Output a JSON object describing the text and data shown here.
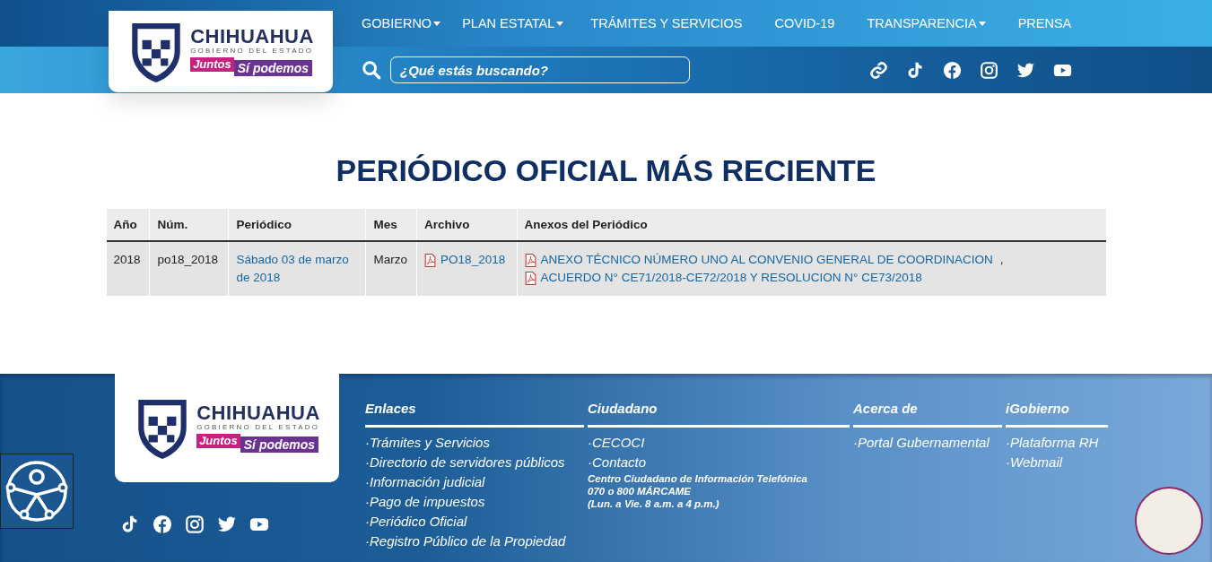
{
  "header": {
    "logo": {
      "name": "CHIHUAHUA",
      "subtitle": "GOBIERNO DEL ESTADO",
      "slogan_1": "Juntos",
      "slogan_2": "Sí podemos"
    },
    "nav": [
      {
        "label": "GOBIERNO",
        "dropdown": true
      },
      {
        "label": "PLAN ESTATAL",
        "dropdown": true
      },
      {
        "label": "TRÁMITES Y SERVICIOS",
        "dropdown": false
      },
      {
        "label": "COVID-19",
        "dropdown": false
      },
      {
        "label": "TRANSPARENCIA",
        "dropdown": true
      },
      {
        "label": "PRENSA",
        "dropdown": false
      }
    ],
    "search": {
      "placeholder": "¿Qué estás buscando?"
    }
  },
  "main": {
    "title": "PERIÓDICO OFICIAL MÁS RECIENTE",
    "table": {
      "columns": [
        "Año",
        "Núm.",
        "Periódico",
        "Mes",
        "Archivo",
        "Anexos del Periódico"
      ],
      "rows": [
        {
          "year": "2018",
          "number": "po18_2018",
          "periodico": "Sábado 03 de marzo de 2018",
          "month": "Marzo",
          "file": "PO18_2018",
          "annexes": [
            {
              "label": "ANEXO TÉCNICO NÚMERO UNO AL CONVENIO GENERAL DE COORDINACION",
              "separator": ","
            },
            {
              "label": "ACUERDO N° CE71/2018-CE72/2018 Y RESOLUCION N° CE73/2018"
            }
          ]
        }
      ]
    }
  },
  "footer": {
    "logo": {
      "name": "CHIHUAHUA",
      "subtitle": "GOBIERNO DEL ESTADO",
      "slogan_1": "Juntos",
      "slogan_2": "Sí podemos"
    },
    "columns": [
      {
        "heading": "Enlaces",
        "links": [
          "·Trámites y Servicios",
          "·Directorio de servidores públicos",
          "·Información judicial",
          "·Pago de impuestos",
          "·Periódico Oficial",
          "·Registro Público de la Propiedad"
        ]
      },
      {
        "heading": "Ciudadano",
        "links": [
          "·CECOCI",
          "·Contacto"
        ],
        "note": [
          "Centro Ciudadano de Información Telefónica",
          "070 o 800 MÁRCAME",
          "(Lun. a Vie. 8 a.m. a 4 p.m.)"
        ]
      },
      {
        "heading": "Acerca de",
        "links": [
          "·Portal Gubernamental"
        ]
      },
      {
        "heading": "iGobierno",
        "links": [
          "·Plataforma RH",
          "·Webmail"
        ]
      }
    ]
  }
}
